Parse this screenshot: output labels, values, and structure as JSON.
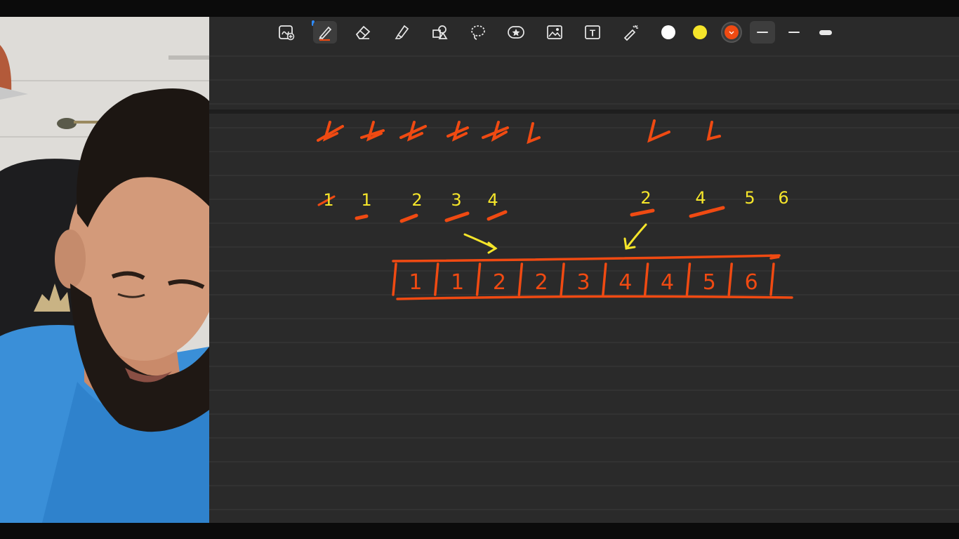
{
  "toolbar": {
    "tools": [
      {
        "id": "insert-page",
        "icon": "add-page-icon"
      },
      {
        "id": "pen",
        "icon": "pen-icon",
        "selected": true
      },
      {
        "id": "eraser",
        "icon": "eraser-icon"
      },
      {
        "id": "highlighter",
        "icon": "highlighter-icon"
      },
      {
        "id": "shapes",
        "icon": "shapes-icon"
      },
      {
        "id": "lasso",
        "icon": "lasso-icon"
      },
      {
        "id": "sticker",
        "icon": "star-sticker-icon"
      },
      {
        "id": "image",
        "icon": "image-icon"
      },
      {
        "id": "text",
        "icon": "text-box-icon",
        "label": "T"
      },
      {
        "id": "laser",
        "icon": "laser-pointer-icon"
      }
    ],
    "colors": [
      {
        "name": "white",
        "hex": "#ffffff"
      },
      {
        "name": "yellow",
        "hex": "#f5e52a"
      },
      {
        "name": "orange",
        "hex": "#f04a12",
        "active": true
      }
    ],
    "stroke_widths": [
      "thin",
      "medium",
      "thick"
    ],
    "selected_stroke": "thin"
  },
  "board": {
    "background": "#2a2a2a",
    "ink_orange": "#f04a12",
    "ink_yellow": "#f5e52a",
    "left_list": [
      "1",
      "1",
      "2",
      "3",
      "4"
    ],
    "right_list": [
      "2",
      "4",
      "5",
      "6"
    ],
    "merged_array": [
      "1",
      "1",
      "2",
      "2",
      "3",
      "4",
      "4",
      "5",
      "6"
    ]
  }
}
